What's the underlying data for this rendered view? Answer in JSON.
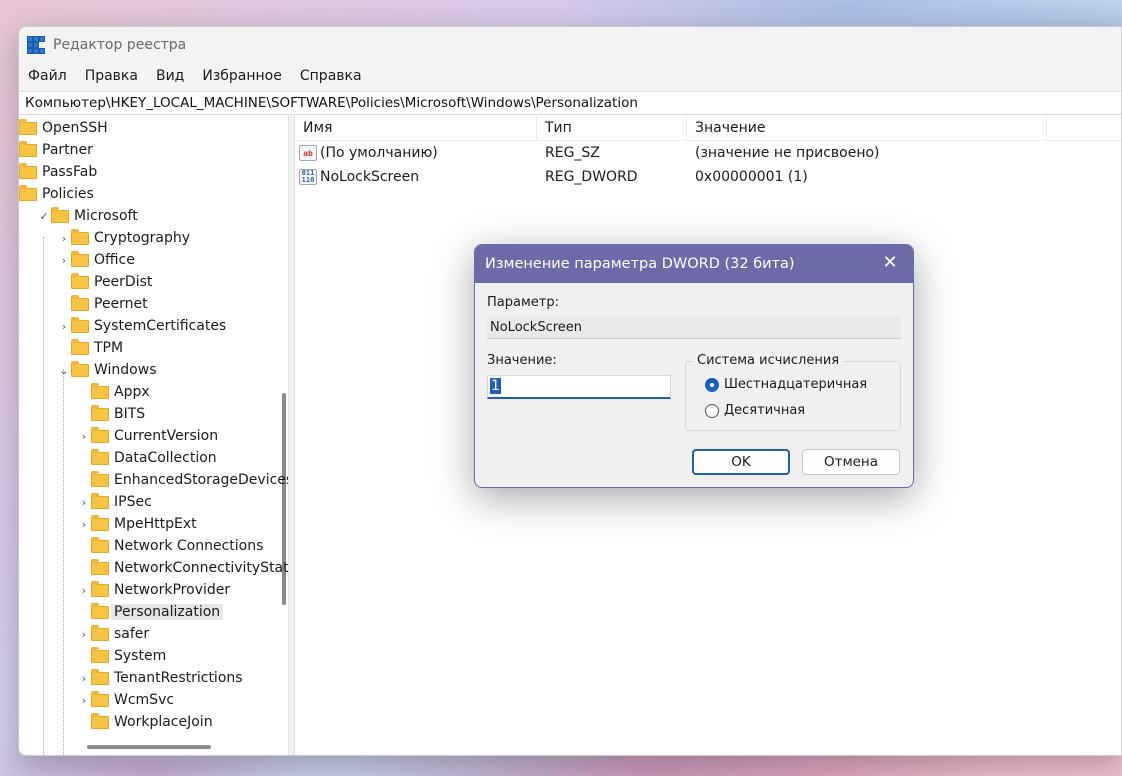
{
  "window": {
    "title": "Редактор реестра",
    "menu": [
      "Файл",
      "Правка",
      "Вид",
      "Избранное",
      "Справка"
    ],
    "address": "Компьютер\\HKEY_LOCAL_MACHINE\\SOFTWARE\\Policies\\Microsoft\\Windows\\Personalization"
  },
  "tree": {
    "items": [
      {
        "label": "OpenSSH",
        "level": 0,
        "arrow": ""
      },
      {
        "label": "Partner",
        "level": 0,
        "arrow": ""
      },
      {
        "label": "PassFab",
        "level": 0,
        "arrow": ""
      },
      {
        "label": "Policies",
        "level": 0,
        "arrow": ""
      },
      {
        "label": "Microsoft",
        "level": 1,
        "arrow": "✓"
      },
      {
        "label": "Cryptography",
        "level": 2,
        "arrow": "›"
      },
      {
        "label": "Office",
        "level": 2,
        "arrow": "›"
      },
      {
        "label": "PeerDist",
        "level": 2,
        "arrow": ""
      },
      {
        "label": "Peernet",
        "level": 2,
        "arrow": ""
      },
      {
        "label": "SystemCertificates",
        "level": 2,
        "arrow": "›"
      },
      {
        "label": "TPM",
        "level": 2,
        "arrow": ""
      },
      {
        "label": "Windows",
        "level": 2,
        "arrow": "⌄"
      },
      {
        "label": "Appx",
        "level": 3,
        "arrow": ""
      },
      {
        "label": "BITS",
        "level": 3,
        "arrow": ""
      },
      {
        "label": "CurrentVersion",
        "level": 3,
        "arrow": "›"
      },
      {
        "label": "DataCollection",
        "level": 3,
        "arrow": ""
      },
      {
        "label": "EnhancedStorageDevices",
        "level": 3,
        "arrow": ""
      },
      {
        "label": "IPSec",
        "level": 3,
        "arrow": "›"
      },
      {
        "label": "MpeHttpExt",
        "level": 3,
        "arrow": "›"
      },
      {
        "label": "Network Connections",
        "level": 3,
        "arrow": ""
      },
      {
        "label": "NetworkConnectivityStatu",
        "level": 3,
        "arrow": ""
      },
      {
        "label": "NetworkProvider",
        "level": 3,
        "arrow": "›"
      },
      {
        "label": "Personalization",
        "level": 3,
        "arrow": "",
        "selected": true
      },
      {
        "label": "safer",
        "level": 3,
        "arrow": "›"
      },
      {
        "label": "System",
        "level": 3,
        "arrow": ""
      },
      {
        "label": "TenantRestrictions",
        "level": 3,
        "arrow": "›"
      },
      {
        "label": "WcmSvc",
        "level": 3,
        "arrow": "›"
      },
      {
        "label": "WorkplaceJoin",
        "level": 3,
        "arrow": ""
      }
    ]
  },
  "list": {
    "columns": [
      "Имя",
      "Тип",
      "Значение"
    ],
    "rows": [
      {
        "icon": "string-value-icon",
        "icon_text": "ab",
        "name": "(По умолчанию)",
        "type": "REG_SZ",
        "value": "(значение не присвоено)"
      },
      {
        "icon": "binary-value-icon",
        "icon_text": "011\n110",
        "name": "NoLockScreen",
        "type": "REG_DWORD",
        "value": "0x00000001 (1)"
      }
    ]
  },
  "dialog": {
    "title": "Изменение параметра DWORD (32 бита)",
    "param_label": "Параметр:",
    "param_value": "NoLockScreen",
    "value_label": "Значение:",
    "value": "1",
    "base_label": "Система исчисления",
    "radio_hex": "Шестнадцатеричная",
    "radio_dec": "Десятичная",
    "ok": "OK",
    "cancel": "Отмена",
    "close_icon": "✕"
  }
}
